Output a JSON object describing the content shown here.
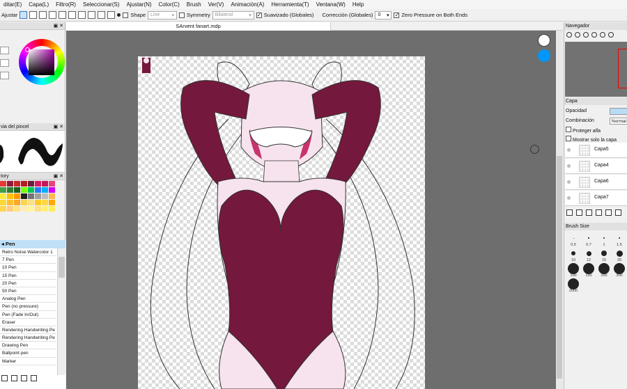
{
  "menu": [
    "ditar(E)",
    "Capa(L)",
    "Filtro(R)",
    "Seleccionar(S)",
    "Ajustar(N)",
    "Color(C)",
    "Brush",
    "Ver(V)",
    "Animación(A)",
    "Herramienta(T)",
    "Ventana(W)",
    "Help"
  ],
  "toolbar": {
    "adjust_label": "Ajustar",
    "shape_label": "Shape",
    "shape_value": "Line",
    "symmetry_label": "Symmetry",
    "symmetry_value": "Bilateral",
    "antialias_label": "Suavizado (Globales)",
    "correction_label": "Corrección (Globales)",
    "correction_value": "0",
    "zero_pressure_label": "Zero Pressure on Both Ends"
  },
  "left": {
    "brush_preview_title": "via del pincel",
    "history_title": "tory",
    "tool_header": "Pen",
    "tools": [
      "Retro Noise Watercolor 1",
      "7 Pen",
      "10 Pen",
      "15 Pen",
      "20 Pen",
      "50 Pen",
      "Analog Pen",
      "Pen (no pressure)",
      "Pen (Fade In/Out)",
      "Eraser",
      "Rendering Handwriting Pe",
      "Rendering Handwriting Pe",
      "Drawing Pen",
      "Ballpoint pen",
      "Marker"
    ],
    "swatches": [
      "#e53935",
      "#8e1b3a",
      "#c62828",
      "#b71c1c",
      "#6d1d3a",
      "#d81b60",
      "#c2185b",
      "#ec407a",
      "#43a047",
      "#2e7d32",
      "#1b5e20",
      "#76ff03",
      "#00c853",
      "#2979ff",
      "#00b0ff",
      "#d500f9",
      "#ffeb3b",
      "#ffc107",
      "#ff9800",
      "#212121",
      "#757575",
      "#9e9e9e",
      "#bdbdbd",
      "#ffb74d",
      "#fdd835",
      "#fbc02d",
      "#f9a825",
      "#ffd54f",
      "#ffe082",
      "#ffca28",
      "#ffd740",
      "#ffab00",
      "#ffd54f",
      "#ffcc80",
      "#ffe57f",
      "#ffecb3",
      "#fff59d",
      "#ffe082",
      "#fff176",
      "#ffee58"
    ]
  },
  "document": {
    "tab_title": "SArvent fanart.mdp"
  },
  "right": {
    "navigator_title": "Navegador",
    "layer_panel_title": "Capa",
    "opacity_label": "Opacidad",
    "blend_label": "Combinación",
    "blend_value": "Normal",
    "protect_alpha_label": "Proteger alfa",
    "show_active_label": "Mostrar solo la capa activa",
    "layers": [
      "Capa5",
      "Capa4",
      "Capa6",
      "Capa7"
    ],
    "brush_size_title": "Brush Size",
    "brush_sizes": [
      "0.5",
      "0.7",
      "1",
      "1.5",
      "10",
      "12",
      "15",
      "20",
      "100",
      "150",
      "200",
      "300",
      "2000"
    ]
  },
  "colors": {
    "accent": "#0078d7",
    "suit": "#74183d",
    "skin": "#f7e3ee",
    "pink_shade": "#c8336e"
  }
}
